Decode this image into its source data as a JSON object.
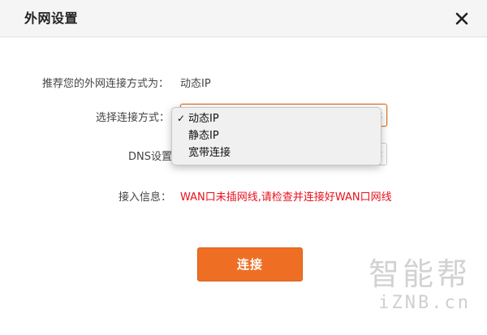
{
  "dialog": {
    "title": "外网设置",
    "close_icon": "close-icon"
  },
  "recommend": {
    "label": "推荐您的外网连接方式为：",
    "value": "动态IP"
  },
  "connection_type": {
    "label": "选择连接方式：",
    "selected": "动态IP",
    "options": [
      "动态IP",
      "静态IP",
      "宽带连接"
    ],
    "checkmark": "✓"
  },
  "dns": {
    "label": "DNS设置"
  },
  "access_info": {
    "label": "接入信息：",
    "message": "WAN口未插网线,请检查并连接好WAN口网线"
  },
  "connect_button": {
    "label": "连接"
  },
  "watermark": {
    "cn": "智能帮",
    "en": "iZNB.cn"
  },
  "colors": {
    "accent": "#ee6f24",
    "error": "#e8101c",
    "header_bg": "#f5f5f5"
  }
}
